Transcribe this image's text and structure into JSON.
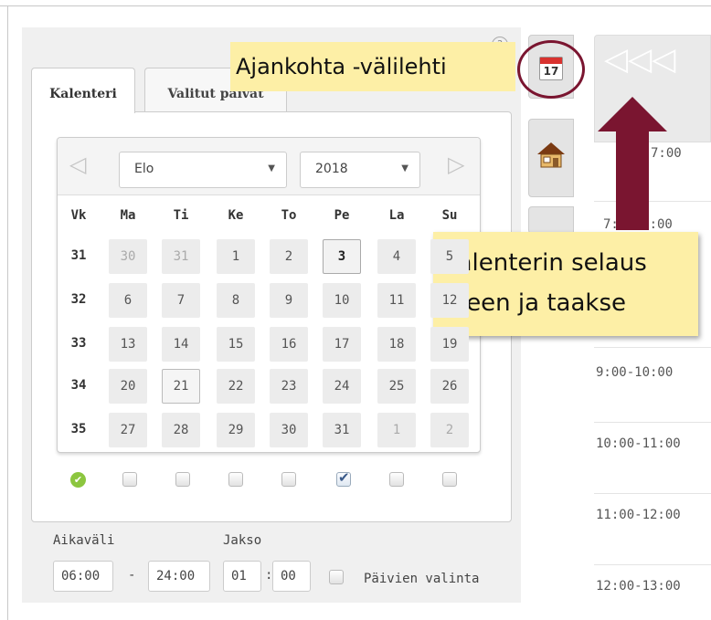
{
  "callouts": {
    "tab_label": "Ajankohta -välilehti",
    "nav_line1": "Kalenterin selaus",
    "nav_line2": "eteen ja taakse"
  },
  "help_icon": "?",
  "tabs": [
    {
      "label": "Kalenteri",
      "active": true
    },
    {
      "label": "Valitut päivät",
      "active": false
    }
  ],
  "calendar": {
    "month": "Elo",
    "year": "2018",
    "prev_icon": "◁",
    "next_icon": "▷",
    "headers": [
      "Vk",
      "Ma",
      "Ti",
      "Ke",
      "To",
      "Pe",
      "La",
      "Su"
    ],
    "weeks": [
      {
        "week": "31",
        "days": [
          "30",
          "31",
          "1",
          "2",
          "3",
          "4",
          "5"
        ]
      },
      {
        "week": "32",
        "days": [
          "6",
          "7",
          "8",
          "9",
          "10",
          "11",
          "12"
        ]
      },
      {
        "week": "33",
        "days": [
          "13",
          "14",
          "15",
          "16",
          "17",
          "18",
          "19"
        ]
      },
      {
        "week": "34",
        "days": [
          "20",
          "21",
          "22",
          "23",
          "24",
          "25",
          "26"
        ]
      },
      {
        "week": "35",
        "days": [
          "27",
          "28",
          "29",
          "30",
          "31",
          "1",
          "2"
        ]
      }
    ],
    "weekday_checks": [
      false,
      false,
      false,
      false,
      true,
      false,
      false
    ]
  },
  "time_range": {
    "aikavali_label": "Aikaväli",
    "start": "06:00",
    "dash": "-",
    "end": "24:00",
    "jakso_label": "Jakso",
    "jakso_h": "01",
    "colon": ":",
    "jakso_m": "00",
    "paivien_valinta": "Päivien valinta"
  },
  "side_icons": {
    "calendar_day": "17"
  },
  "right_panel": {
    "nav_icons": "◁◁◁",
    "times": [
      "7:00",
      "7:00-8:00",
      "9:00-10:00",
      "10:00-11:00",
      "11:00-12:00",
      "12:00-13:00"
    ]
  },
  "colors": {
    "callout_bg": "#fdefa6",
    "annotation": "#7a1530",
    "check_green": "#8cc63f"
  }
}
